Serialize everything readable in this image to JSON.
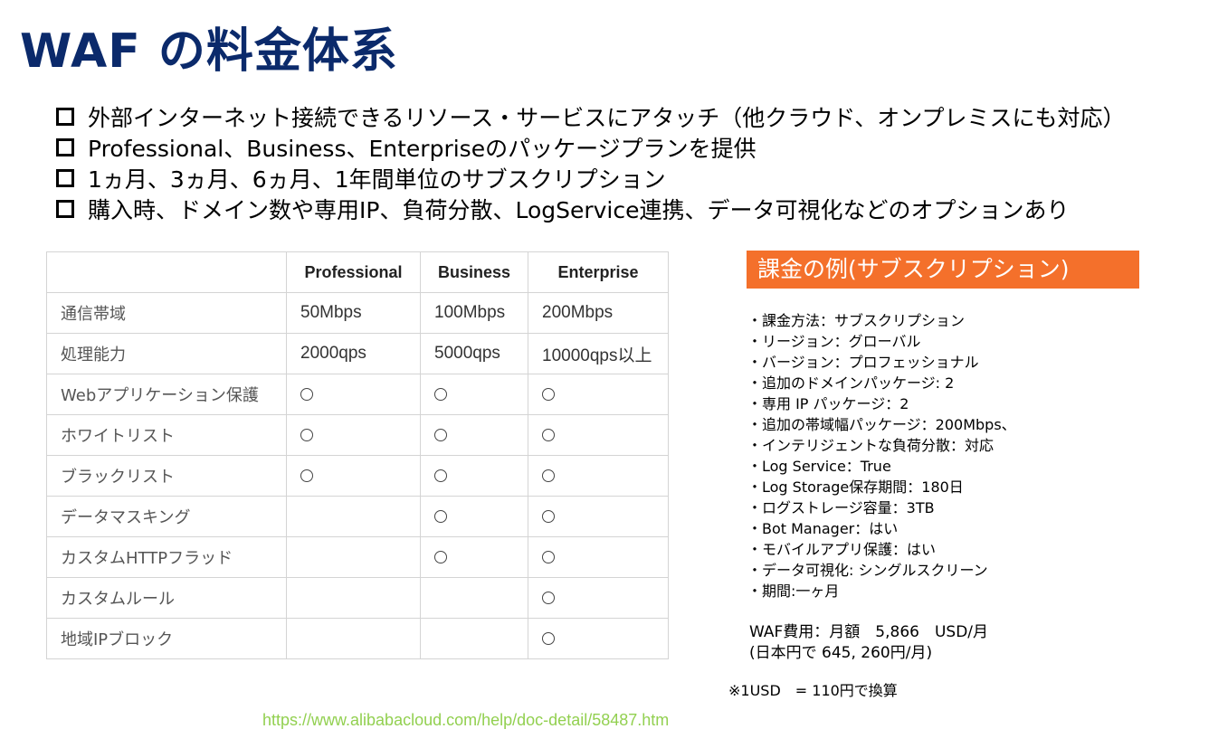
{
  "title": "WAF の料金体系",
  "bullets": [
    "外部インターネット接続できるリソース・サービスにアタッチ（他クラウド、オンプレミスにも対応）",
    "Professional、Business、Enterpriseのパッケージプランを提供",
    "1ヵ月、3ヵ月、6ヵ月、1年間単位のサブスクリプション",
    "購入時、ドメイン数や専用IP、負荷分散、LogService連携、データ可視化などのオプションあり"
  ],
  "table": {
    "headers": [
      "",
      "Professional",
      "Business",
      "Enterprise"
    ],
    "rows": [
      {
        "feature": "通信帯域",
        "values": [
          "50Mbps",
          "100Mbps",
          "200Mbps"
        ]
      },
      {
        "feature": "処理能力",
        "values": [
          "2000qps",
          "5000qps",
          "10000qps以上"
        ]
      },
      {
        "feature": "Webアプリケーション保護",
        "marks": [
          true,
          true,
          true
        ]
      },
      {
        "feature": "ホワイトリスト",
        "marks": [
          true,
          true,
          true
        ]
      },
      {
        "feature": "ブラックリスト",
        "marks": [
          true,
          true,
          true
        ]
      },
      {
        "feature": "データマスキング",
        "marks": [
          false,
          true,
          true
        ]
      },
      {
        "feature": "カスタムHTTPフラッド",
        "marks": [
          false,
          true,
          true
        ]
      },
      {
        "feature": "カスタムルール",
        "marks": [
          false,
          false,
          true
        ]
      },
      {
        "feature": "地域IPブロック",
        "marks": [
          false,
          false,
          true
        ]
      }
    ]
  },
  "example": {
    "header": "課金の例(サブスクリプション)",
    "header_color": "#f4702b",
    "details": [
      "・課金方法：サブスクリプション",
      "・リージョン：グローバル",
      "・バージョン：プロフェッショナル",
      "・追加のドメインパッケージ: 2",
      "・専用 IP パッケージ：2",
      "・追加の帯域幅パッケージ：200Mbps、",
      "・インテリジェントな負荷分散：対応",
      "・Log Service：True",
      "・Log Storage保存期間：180日",
      "・ログストレージ容量：3TB",
      "・Bot Manager：はい",
      "・モバイルアプリ保護：はい",
      "・データ可視化: シングルスクリーン",
      "・期間:一ヶ月"
    ],
    "cost_line1": "WAF費用：月額　5,866　USD/月",
    "cost_line2": "(日本円で 645, 260円/月)"
  },
  "note": "※1USD　= 110円で換算",
  "url": "https://www.alibabacloud.com/help/doc-detail/58487.htm",
  "colors": {
    "title": "#0b2a6b",
    "url": "#92d050"
  }
}
